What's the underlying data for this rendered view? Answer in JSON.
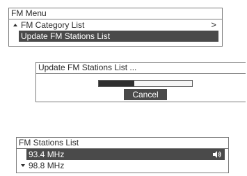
{
  "menu": {
    "title": "FM Menu",
    "items": [
      {
        "label": "FM Category List",
        "chevron": ">",
        "selected": false,
        "icon": "arrow-up-icon"
      },
      {
        "label": "Update FM Stations List",
        "selected": true
      }
    ]
  },
  "update_dialog": {
    "title": "Update FM Stations List ...",
    "progress": 0.38,
    "cancel_label": "Cancel"
  },
  "stations": {
    "title": "FM Stations List",
    "items": [
      {
        "label": "93.4 MHz",
        "selected": true,
        "icon": "speaker-icon"
      },
      {
        "label": "98.8 MHz",
        "selected": false,
        "icon": "arrow-down-icon"
      }
    ]
  },
  "colors": {
    "highlight": "#4a4a4a",
    "text": "#2b2b2b",
    "border": "#7a7a7a"
  }
}
